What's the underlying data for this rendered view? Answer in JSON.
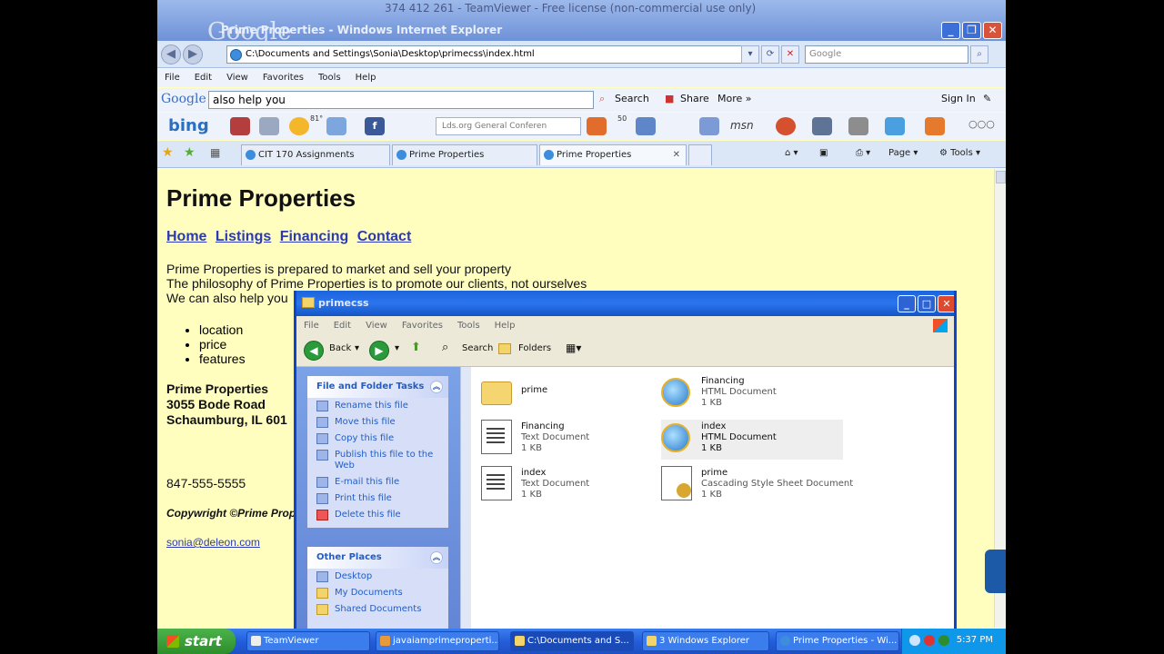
{
  "banner": {
    "teamviewer_title": "374 412 261 - TeamViewer - Free license (non-commercial use only)",
    "ie_title": "Prime Properties - Windows Internet Explorer",
    "google_overlay": "Google"
  },
  "browser": {
    "address": "C:\\Documents and Settings\\Sonia\\Desktop\\primecss\\index.html",
    "search_placeholder": "Google",
    "menu": [
      "File",
      "Edit",
      "View",
      "Favorites",
      "Tools",
      "Help"
    ],
    "google_toolbar": {
      "logo": "Google",
      "query": "also help you",
      "search_label": "Search",
      "share_label": "Share",
      "more_label": "More »",
      "signin_label": "Sign In"
    },
    "bing_toolbar": {
      "logo": "bing",
      "lds_field": "Lds.org General Conferen",
      "msn_label": "msn",
      "weather_temp": "81°",
      "likes_count": "50"
    },
    "tabs": [
      "CIT 170 Assignments",
      "Prime Properties",
      "Prime Properties"
    ],
    "commands": {
      "page": "Page",
      "tools": "Tools"
    }
  },
  "page": {
    "title": "Prime Properties",
    "nav": [
      "Home",
      "Listings",
      "Financing",
      "Contact"
    ],
    "para1": "Prime Properties is prepared to market and sell your property",
    "para2": "The philosophy of Prime Properties is to promote our clients, not ourselves",
    "para3": "We can also help you",
    "bullets": [
      "location",
      "price",
      "features"
    ],
    "address": {
      "name": "Prime Properties",
      "street": "3055 Bode Road",
      "city": "Schaumburg, IL 601"
    },
    "phone": "847-555-5555",
    "copyright": "Copywright ©Prime Prop",
    "email": "sonia@deleon.com"
  },
  "explorer": {
    "title": "primecss",
    "menu": [
      "File",
      "Edit",
      "View",
      "Favorites",
      "Tools",
      "Help"
    ],
    "toolbar": {
      "back": "Back",
      "search": "Search",
      "folders": "Folders"
    },
    "tasks_header": "File and Folder Tasks",
    "tasks": [
      "Rename this file",
      "Move this file",
      "Copy this file",
      "Publish this file to the Web",
      "E-mail this file",
      "Print this file",
      "Delete this file"
    ],
    "places_header": "Other Places",
    "places": [
      "Desktop",
      "My Documents",
      "Shared Documents"
    ],
    "files": [
      {
        "name": "prime",
        "type": "",
        "size": ""
      },
      {
        "name": "Financing",
        "type": "HTML Document",
        "size": "1 KB"
      },
      {
        "name": "Financing",
        "type": "Text Document",
        "size": "1 KB"
      },
      {
        "name": "index",
        "type": "HTML Document",
        "size": "1 KB"
      },
      {
        "name": "index",
        "type": "Text Document",
        "size": "1 KB"
      },
      {
        "name": "prime",
        "type": "Cascading Style Sheet Document",
        "size": "1 KB"
      }
    ]
  },
  "taskbar": {
    "start": "start",
    "tasks": [
      "TeamViewer",
      "javaiamprimeproperti...",
      "C:\\Documents and S...",
      "3 Windows Explorer",
      "Prime Properties - Wi..."
    ],
    "clock": "5:37 PM"
  },
  "colors": {
    "page_bg": "#fffebf",
    "link": "#2b3ab4",
    "xp_blue": "#0d46c8",
    "start_green": "#3a9e38"
  }
}
